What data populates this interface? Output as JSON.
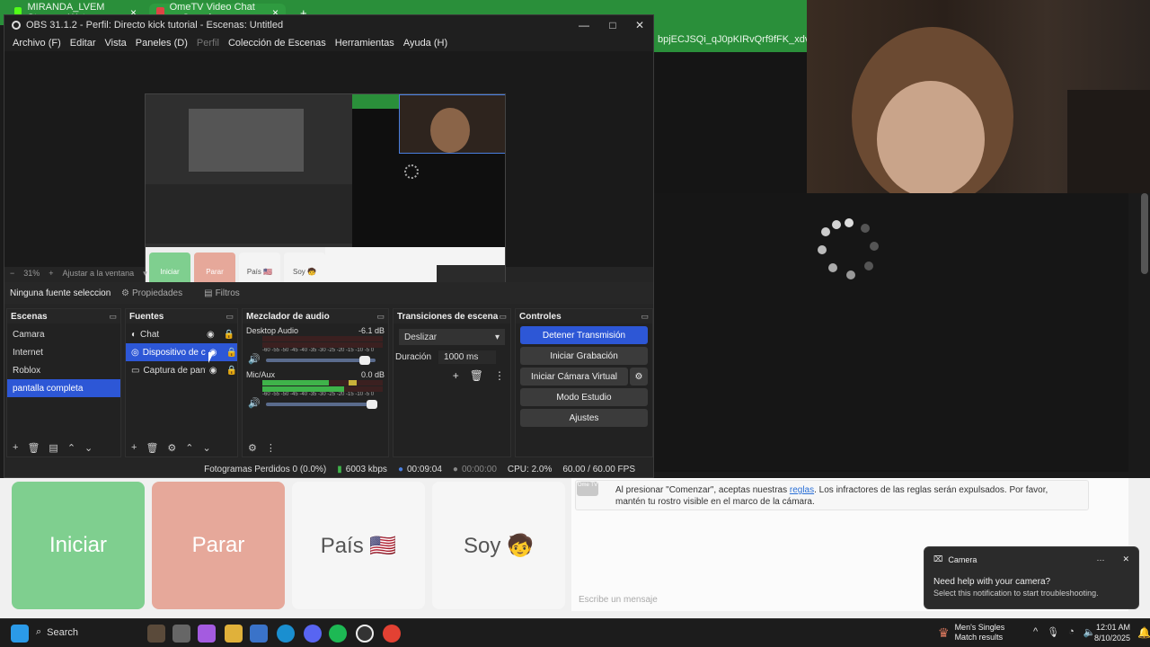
{
  "browser": {
    "tabs": [
      {
        "label": "MIRANDA_LVEM Stream - Wat",
        "close": "×",
        "icon_color": "#1e1e1e"
      },
      {
        "label": "OmeTV Video Chat — Omegle",
        "close": "×",
        "icon_color": "#d44"
      }
    ],
    "new_tab": "+",
    "url_fragment": "bpjECJSQi_qJ0pKIRvQrf9fFK_xdvylzMum"
  },
  "obs": {
    "title": "OBS 31.1.2 - Perfil: Directo kick tutorial - Escenas: Untitled",
    "window_controls": {
      "minimize": "—",
      "maximize": "□",
      "close": "✕"
    },
    "menu": [
      "Archivo (F)",
      "Editar",
      "Vista",
      "Paneles (D)",
      "Perfil",
      "Colección de Escenas",
      "Herramientas",
      "Ayuda (H)"
    ],
    "zoom": {
      "minus": "−",
      "percent": "31%",
      "plus": "+",
      "fit": "Ajustar a la ventana",
      "chevron": "▾"
    },
    "source_toolbar": {
      "no_source": "Ninguna fuente seleccionada",
      "properties": "Propiedades",
      "filters": "Filtros"
    },
    "preview": {
      "buttons": [
        "Iniciar",
        "Parar",
        "País 🇺🇸",
        "Soy 🧒"
      ]
    },
    "scenes": {
      "title": "Escenas",
      "items": [
        "Camara",
        "Internet",
        "Roblox",
        "pantalla completa"
      ],
      "selected_index": 3
    },
    "sources": {
      "title": "Fuentes",
      "items": [
        {
          "label": "Chat",
          "selected": false,
          "icon": "chat-browser-icon"
        },
        {
          "label": "Dispositivo de captura de video",
          "selected": true,
          "icon": "camera-icon"
        },
        {
          "label": "Captura de pantalla",
          "selected": false,
          "icon": "monitor-icon"
        }
      ]
    },
    "mixer": {
      "title": "Mezclador de audio",
      "channels": [
        {
          "name": "Desktop Audio",
          "db": "-6.1 dB",
          "level": 0.0,
          "volume": 0.85
        },
        {
          "name": "Mic/Aux",
          "db": "0.0 dB",
          "level": 0.68,
          "volume": 1.0
        }
      ],
      "scale": "-60 -55 -50 -45 -40 -35 -30 -25 -20 -15 -10 -5 0"
    },
    "transitions": {
      "title": "Transiciones de escena",
      "type": "Deslizar",
      "duration_label": "Duración",
      "duration_value": "1000 ms"
    },
    "controls": {
      "title": "Controles",
      "buttons": [
        "Detener Transmisión",
        "Iniciar Grabación",
        "Iniciar Cámara Virtual",
        "Modo Estudio",
        "Ajustes"
      ]
    },
    "status": {
      "dropped": "Fotogramas Perdidos 0 (0.0%)",
      "bitrate": "6003 kbps",
      "stream_time": "00:09:04",
      "rec_time": "00:00:00",
      "cpu": "CPU: 2.0%",
      "fps": "60.00 / 60.00 FPS"
    }
  },
  "omegle": {
    "buttons": [
      {
        "label": "Iniciar",
        "color": "#7fcf8f"
      },
      {
        "label": "Parar",
        "color": "#e6a89a"
      },
      {
        "label": "País 🇺🇸",
        "color": "#f6f6f6"
      },
      {
        "label": "Soy 🧒",
        "color": "#f6f6f6"
      }
    ],
    "notice_before": "Al presionar \"Comenzar\", aceptas nuestras ",
    "notice_link": "reglas",
    "notice_after": ". Los infractores de las reglas serán expulsados. Por favor, mantén tu rostro visible en el marco de la cámara.",
    "badge": "Ome TV",
    "message_placeholder": "Escribe un mensaje"
  },
  "toast": {
    "app": "Camera",
    "title": "Need help with your camera?",
    "body": "Select this notification to start troubleshooting.",
    "more": "···",
    "close": "✕"
  },
  "taskbar": {
    "search": "Search",
    "widget_title": "Men's Singles",
    "widget_sub": "Match results",
    "time": "12:01 AM",
    "date": "8/10/2025",
    "tray": "^"
  }
}
